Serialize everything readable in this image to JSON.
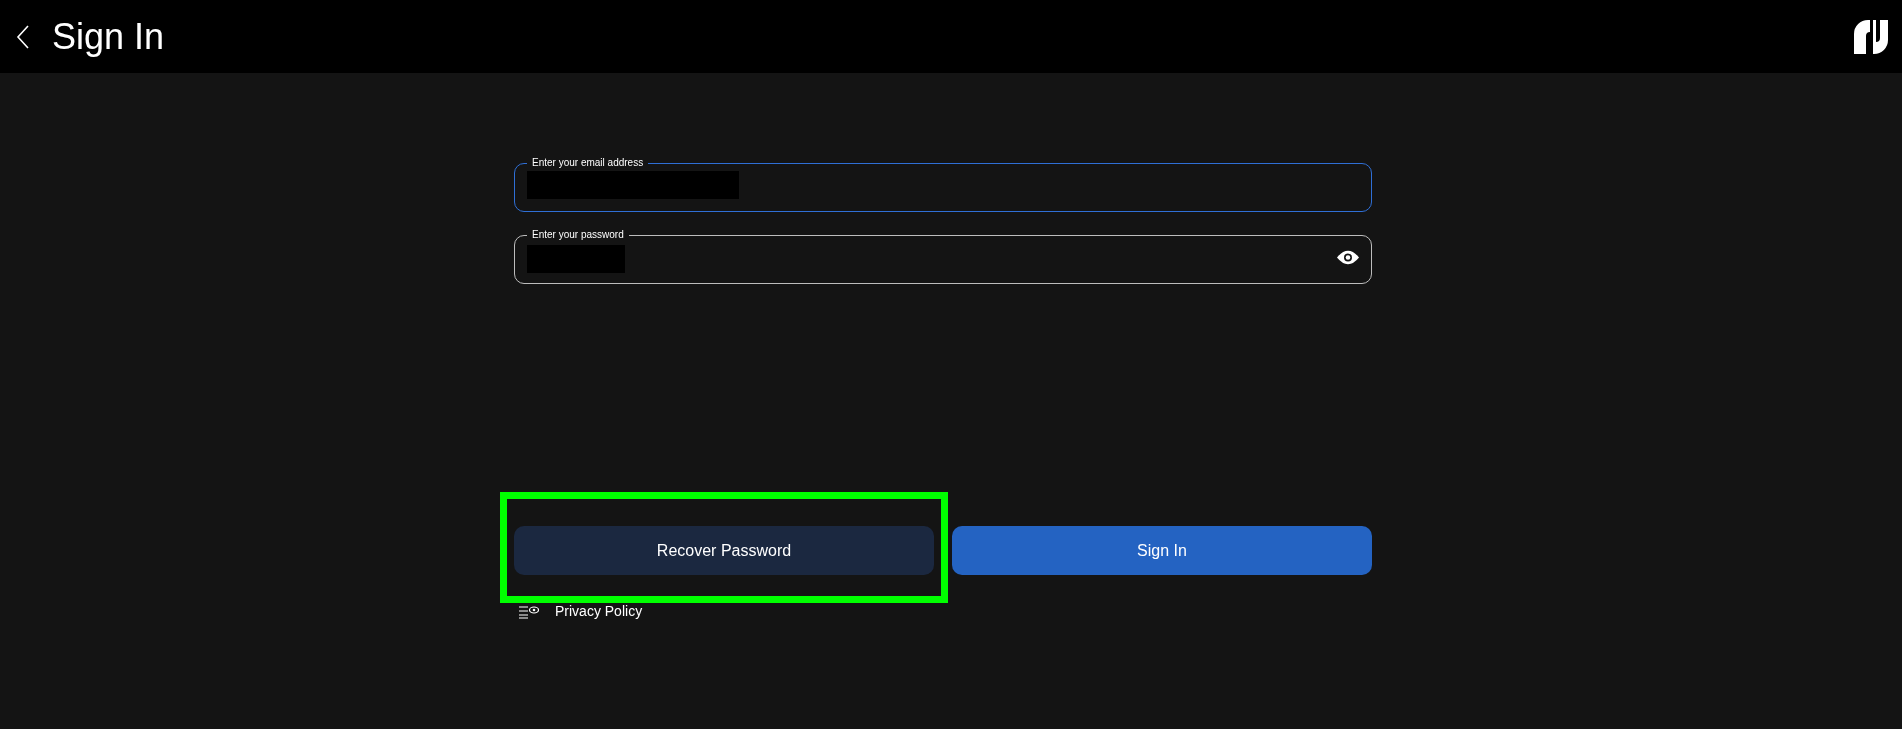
{
  "header": {
    "title": "Sign In"
  },
  "fields": [
    {
      "kind": "email",
      "label": "Enter your email address",
      "focused": true,
      "redacted": true
    },
    {
      "kind": "password",
      "label": "Enter your password",
      "focused": false,
      "redacted": true
    }
  ],
  "buttons": [
    {
      "label": "Recover Password",
      "kind": "secondary",
      "highlighted": true
    },
    {
      "label": "Sign In",
      "kind": "primary"
    }
  ],
  "footer_link": {
    "label": "Privacy Policy"
  }
}
